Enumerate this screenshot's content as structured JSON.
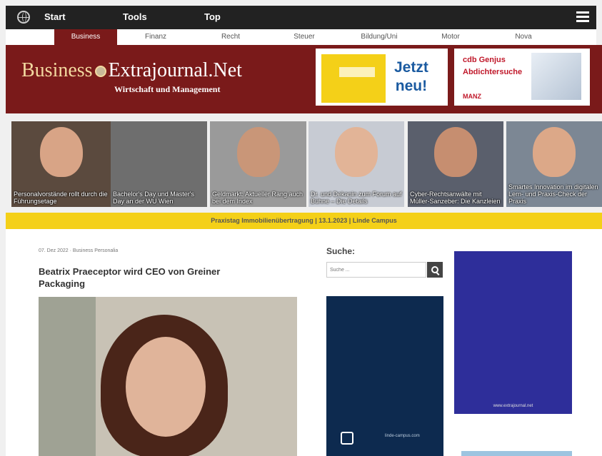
{
  "topnav": {
    "items": [
      "Start",
      "Tools",
      "Top"
    ]
  },
  "secnav": {
    "items": [
      "Business",
      "Finanz",
      "Recht",
      "Steuer",
      "Bildung/Uni",
      "Motor",
      "Nova"
    ],
    "active": "Business"
  },
  "header": {
    "logo_part1": "Business",
    "logo_part2": "Extrajournal.Net",
    "tagline": "Wirtschaft und Management",
    "ad1": {
      "text_line1": "Jetzt",
      "text_line2": "neu!"
    },
    "ad2": {
      "line1": "cdb Genjus",
      "line2": "Abdichtersuche",
      "line3": "MANZ"
    }
  },
  "strip": [
    {
      "caption": "Personalvorstände rollt durch die Führungsetage"
    },
    {
      "caption": "Bachelor's Day und Master's Day an der WU Wien"
    },
    {
      "caption": "Geldmarkt: Aktueller Rang auch bei dem Index"
    },
    {
      "caption": "Dr. und Dekanin zum Forum auf Bühne – Die Details"
    },
    {
      "caption": "Cyber-Rechtsanwälte mit Müller-Sanzeber: Die Kanzleien"
    },
    {
      "caption": "Smartes Innovation im digitalen Lern- und Praxis-Check der Praxis"
    }
  ],
  "banner": {
    "text": "Praxistag Immobilienübertragung | 13.1.2023 | Linde Campus"
  },
  "article": {
    "meta": "07. Dez 2022 · Business Personalia",
    "title": "Beatrix Praeceptor wird CEO von Greiner Packaging"
  },
  "sidebar": {
    "search_label": "Suche:",
    "search_placeholder": "Suche ...",
    "ad1_url": "linde-campus.com",
    "ad2_url": "www.extrajournal.net"
  },
  "colors": {
    "brand": "#7a1a1a",
    "topbar": "#222222",
    "banner": "#f4d018"
  }
}
